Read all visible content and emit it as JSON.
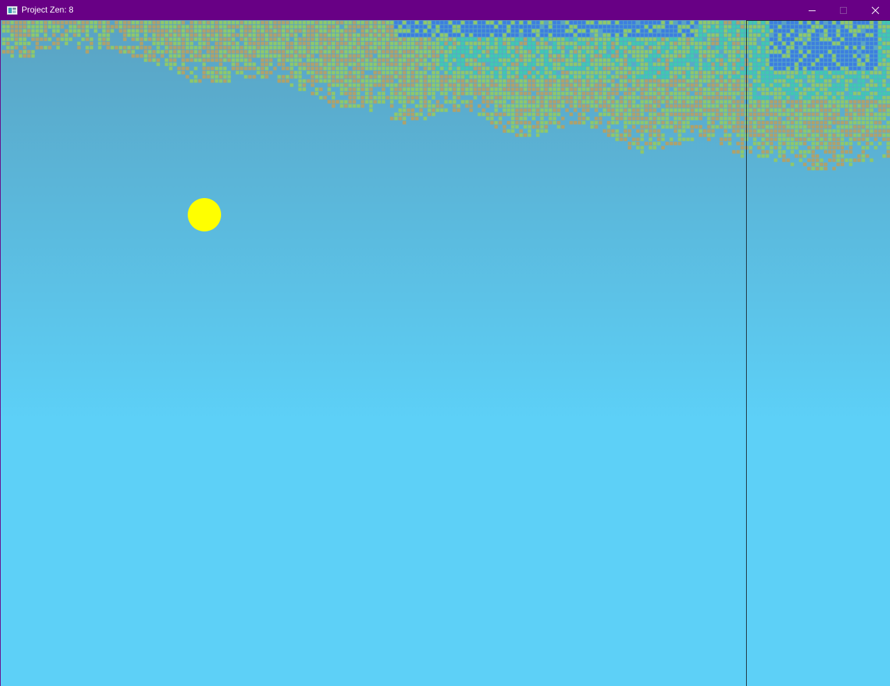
{
  "window": {
    "title": "Project Zen: 8",
    "titlebar_color": "#680085",
    "icons": {
      "app": "app-window-icon",
      "minimize": "minimize-icon",
      "maximize": "maximize-icon",
      "close": "close-icon"
    }
  },
  "scene": {
    "sky_colors": [
      "#5aa3c3",
      "#5dd0f7"
    ],
    "sun_color": "#ffff00",
    "tile_palette": {
      "sand": "#b0a16a",
      "grass": "#8fc86a",
      "sea": "#40c8b0",
      "deep": "#3c7ee0",
      "gap": "#6aa0a8"
    }
  }
}
